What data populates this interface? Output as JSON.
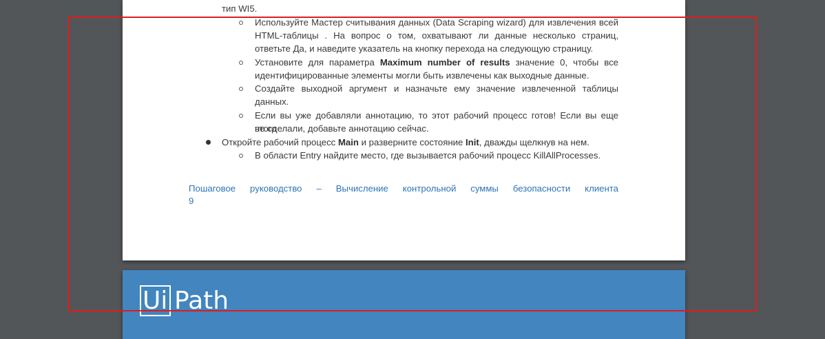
{
  "document": {
    "top_fragment": "тип WI5.",
    "sub_items": [
      {
        "lines": [
          "Используйте Мастер считывания данных (Data Scraping wizard) для извлечения всей",
          "HTML-таблицы . На вопрос о том, охватывают ли данные несколько страниц,",
          "ответьте Да, и наведите указатель на кнопку перехода на следующую страницу."
        ]
      },
      {
        "line1_before": "Установите для параметра",
        "line1_bold": "Maximum number of results",
        "line1_after": "значение 0, чтобы все",
        "line2": "идентифицированные элементы могли быть извлечены как выходные данные."
      },
      {
        "lines": [
          "Создайте выходной аргумент и назначьте ему значение извлеченной таблицы",
          "данных."
        ]
      },
      {
        "lines": [
          "Если вы уже добавляли аннотацию, то этот рабочий процесс готов! Если вы еще этого",
          "не сделали, добавьте аннотацию сейчас."
        ]
      }
    ],
    "main_bullet": {
      "before": "Откройте рабочий процесс",
      "bold1": "Main",
      "middle": "и разверните состояние",
      "bold2": "Init",
      "after": ", дважды щелкнув на нем."
    },
    "last_sub_item": "В области Entry найдите место, где вызывается рабочий процесс KillAllProcesses.",
    "footer_link_line1": "Пошаговое руководство – Вычисление контрольной суммы безопасности клиента",
    "page_number": "9"
  },
  "next_page": {
    "logo_ui": "Ui",
    "logo_path": "Path"
  },
  "colors": {
    "link": "#2e74b5",
    "brand": "#4285bf",
    "selection": "#e01b1b"
  }
}
